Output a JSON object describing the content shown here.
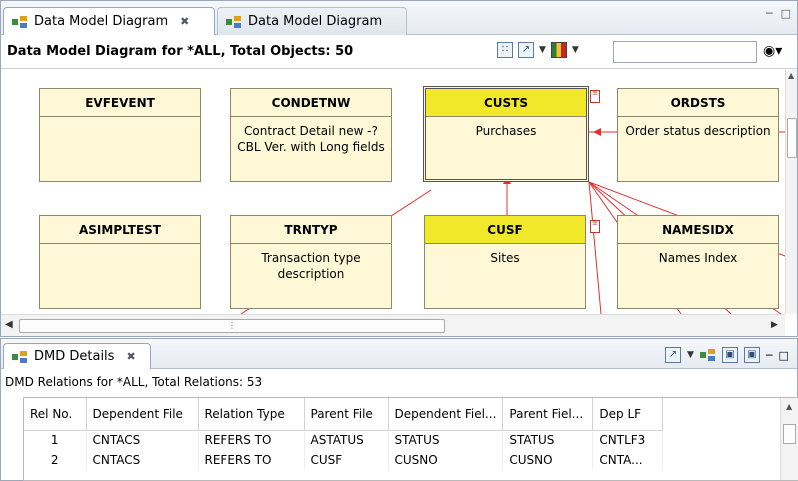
{
  "editor": {
    "tabs": [
      {
        "label": "Data Model Diagram",
        "close": "✖"
      },
      {
        "label": "Data Model Diagram"
      }
    ],
    "title": "Data Model Diagram for *ALL, Total Objects: 50",
    "search_value": ""
  },
  "entities": [
    {
      "name": "EVFEVENT",
      "desc": ""
    },
    {
      "name": "CONDETNW",
      "desc": "Contract Detail new -?\nCBL Ver. with Long fields"
    },
    {
      "name": "CUSTS",
      "desc": "Purchases"
    },
    {
      "name": "ORDSTS",
      "desc": "Order status description"
    },
    {
      "name": "ASIMPLTEST",
      "desc": ""
    },
    {
      "name": "TRNTYP",
      "desc": "Transaction type\ndescription"
    },
    {
      "name": "CUSF",
      "desc": "Sites"
    },
    {
      "name": "NAMESIDX",
      "desc": "Names Index"
    }
  ],
  "details": {
    "tab_label": "DMD Details",
    "title": "DMD Relations for *ALL, Total Relations: 53",
    "columns": [
      "Rel No.",
      "Dependent File",
      "Relation Type",
      "Parent File",
      "Dependent Fiel...",
      "Parent Fiel...",
      "Dep LF"
    ],
    "rows": [
      [
        "1",
        "CNTACS",
        "REFERS TO",
        "ASTATUS",
        "STATUS",
        "STATUS",
        "CNTLF3"
      ],
      [
        "2",
        "CNTACS",
        "REFERS TO",
        "CUSF",
        "CUSNO",
        "CUSNO",
        "CNTA..."
      ]
    ]
  },
  "colors": {
    "entity_fill": "#fff8d6",
    "entity_highlight": "#f2e82a",
    "relation_line": "#e03030"
  }
}
